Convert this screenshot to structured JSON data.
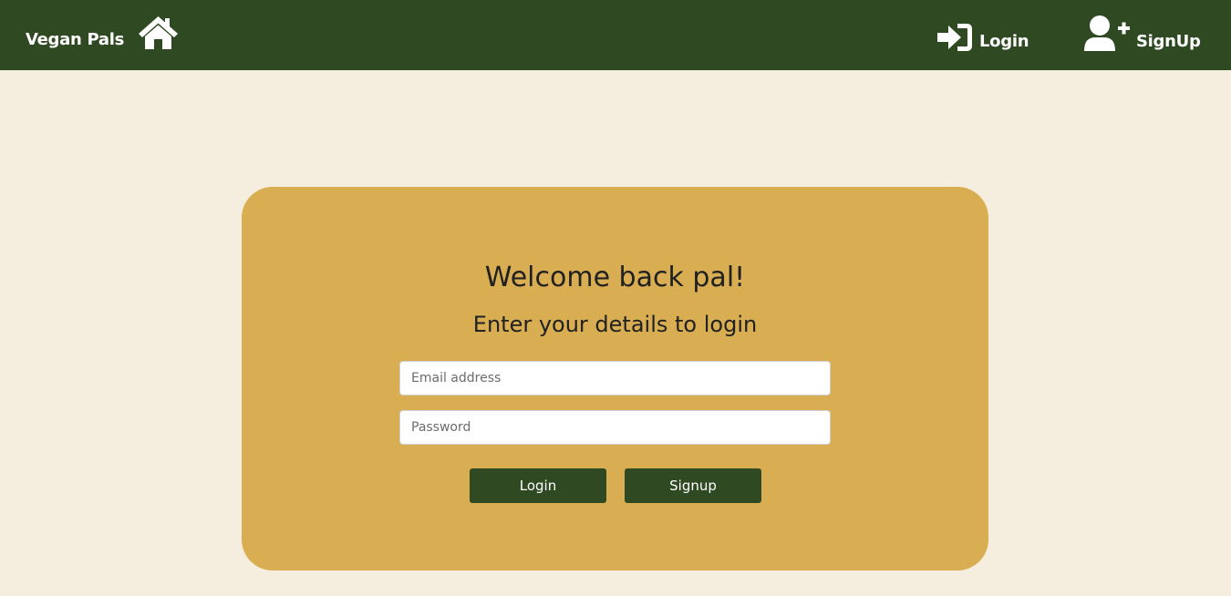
{
  "nav": {
    "brand": "Vegan Pals",
    "home_icon": "home-icon",
    "login_label": "Login",
    "login_icon": "sign-in-icon",
    "signup_label": "SignUp",
    "signup_icon": "user-plus-icon"
  },
  "form": {
    "heading": "Welcome back pal!",
    "subheading": "Enter your details to login",
    "email_placeholder": "Email address",
    "password_placeholder": "Password",
    "login_button": "Login",
    "signup_button": "Signup"
  },
  "colors": {
    "navbar": "#2f4a23",
    "page_background": "#f5eedf",
    "card": "#d9ae52",
    "button": "#2f4a23"
  }
}
